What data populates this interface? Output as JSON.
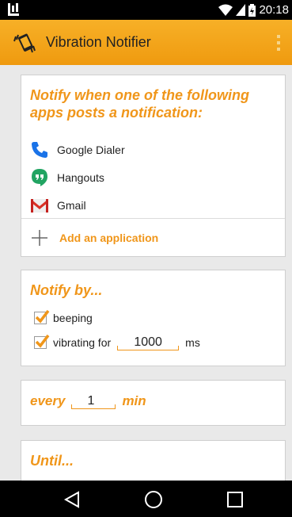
{
  "status_bar": {
    "time": "20:18",
    "icons": [
      "app-notification-icon",
      "wifi-icon",
      "signal-icon",
      "battery-icon"
    ]
  },
  "app_bar": {
    "title": "Vibration Notifier",
    "logo_icon": "vibrating-phone-icon",
    "menu_icon": "overflow-menu-icon"
  },
  "apps_section": {
    "title": "Notify when one of the following apps posts a notification:",
    "apps": [
      {
        "name": "Google Dialer",
        "icon": "phone-icon",
        "color": "#1a73e8"
      },
      {
        "name": "Hangouts",
        "icon": "hangouts-icon",
        "color": "#21a462"
      },
      {
        "name": "Gmail",
        "icon": "gmail-icon",
        "color": "#d93025"
      }
    ],
    "add_label": "Add an application"
  },
  "notify_section": {
    "title": "Notify by...",
    "beeping_label": "beeping",
    "beeping_checked": true,
    "vibrating_label": "vibrating for",
    "vibrating_checked": true,
    "vibrating_value": "1000",
    "vibrating_unit": "ms"
  },
  "every_section": {
    "prefix": "every",
    "value": "1",
    "unit": "min"
  },
  "until_section": {
    "title": "Until..."
  },
  "nav_bar": {
    "buttons": [
      "back-icon",
      "home-icon",
      "recents-icon"
    ]
  },
  "colors": {
    "accent": "#f0961a",
    "app_bar": "#f4a51c"
  }
}
